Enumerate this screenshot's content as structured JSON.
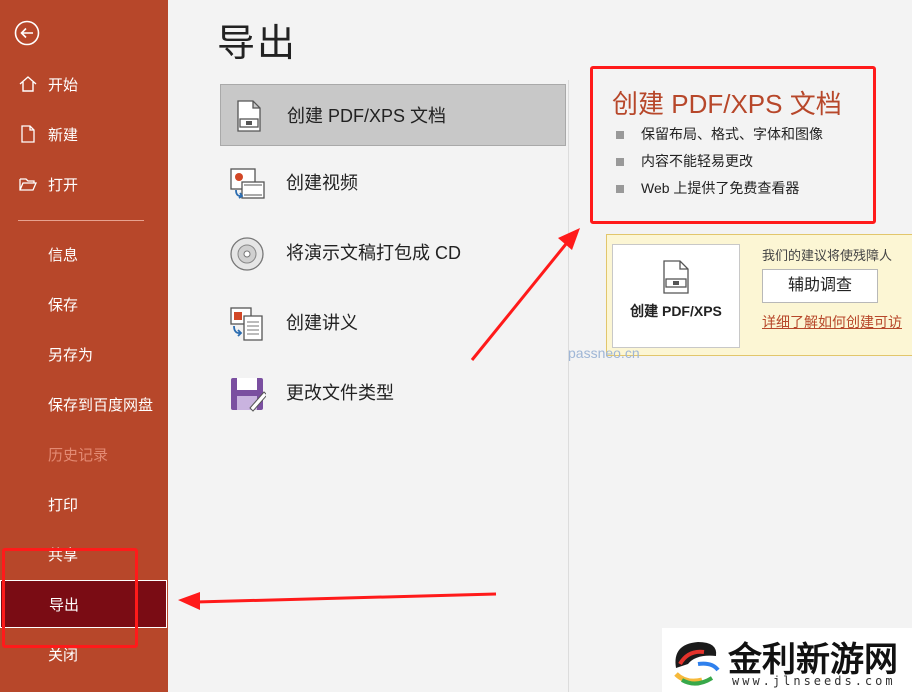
{
  "sidebar": {
    "items": [
      {
        "label": "开始"
      },
      {
        "label": "新建"
      },
      {
        "label": "打开"
      },
      {
        "label": "信息"
      },
      {
        "label": "保存"
      },
      {
        "label": "另存为"
      },
      {
        "label": "保存到百度网盘"
      },
      {
        "label": "历史记录"
      },
      {
        "label": "打印"
      },
      {
        "label": "共享"
      },
      {
        "label": "导出"
      },
      {
        "label": "关闭"
      }
    ],
    "accent": "#b7472a",
    "selected_color": "#7a0c14"
  },
  "main": {
    "title": "导出",
    "options": [
      {
        "label": "创建 PDF/XPS 文档",
        "icon": "pdf-document-icon"
      },
      {
        "label": "创建视频",
        "icon": "video-icon"
      },
      {
        "label": "将演示文稿打包成 CD",
        "icon": "cd-icon"
      },
      {
        "label": "创建讲义",
        "icon": "handout-icon"
      },
      {
        "label": "更改文件类型",
        "icon": "file-type-icon"
      }
    ]
  },
  "detail": {
    "title": "创建 PDF/XPS 文档",
    "bullets": [
      "保留布局、格式、字体和图像",
      "内容不能轻易更改",
      "Web 上提供了免费查看器"
    ],
    "create_button": "创建 PDF/XPS",
    "hint": "我们的建议将使残障人",
    "assist_button": "辅助调查",
    "learn_link": "详细了解如何创建可访"
  },
  "watermark": "passneo.cn",
  "logo": {
    "text": "金利新游网",
    "url": "www.jlnseeds.com"
  }
}
